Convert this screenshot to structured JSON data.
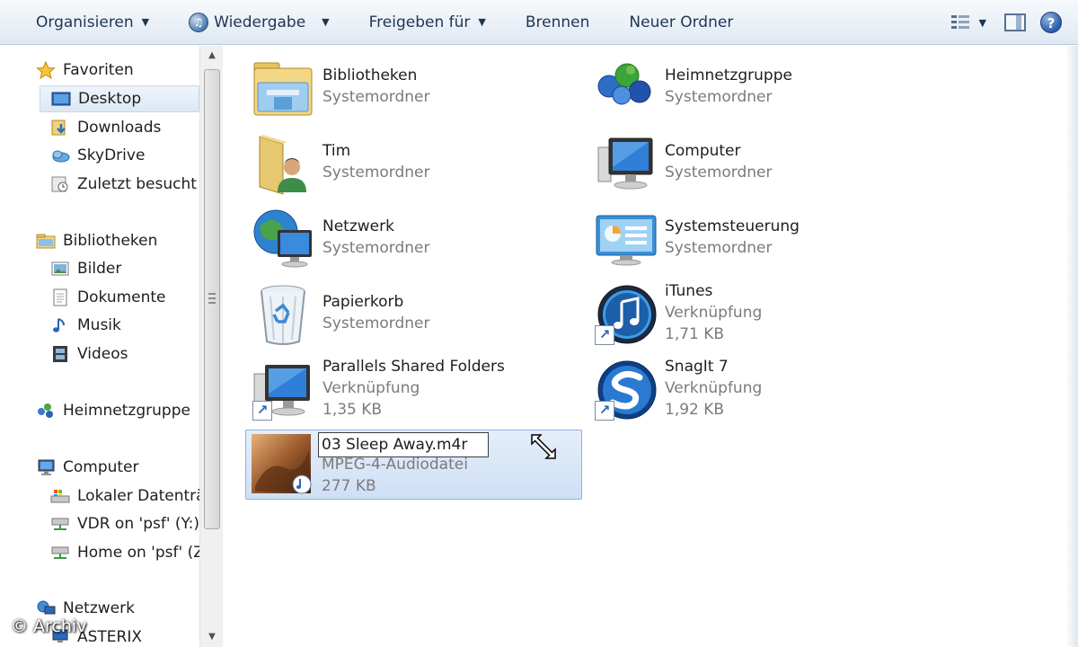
{
  "toolbar": {
    "organize": "Organisieren",
    "play": "Wiedergabe",
    "share": "Freigeben für",
    "burn": "Brennen",
    "new_folder": "Neuer Ordner",
    "help": "?"
  },
  "nav": {
    "favorites": {
      "label": "Favoriten",
      "items": [
        "Desktop",
        "Downloads",
        "SkyDrive",
        "Zuletzt besucht"
      ]
    },
    "libraries": {
      "label": "Bibliotheken",
      "items": [
        "Bilder",
        "Dokumente",
        "Musik",
        "Videos"
      ]
    },
    "homegroup": "Heimnetzgruppe",
    "computer": {
      "label": "Computer",
      "items": [
        "Lokaler Datenträg",
        "VDR on 'psf' (Y:)",
        "Home on 'psf' (Z"
      ]
    },
    "network": {
      "label": "Netzwerk",
      "items": [
        "ASTERIX"
      ]
    }
  },
  "items": [
    {
      "name": "Bibliotheken",
      "line2": "Systemordner",
      "line3": "",
      "icon": "library-folder-icon"
    },
    {
      "name": "Heimnetzgruppe",
      "line2": "Systemordner",
      "line3": "",
      "icon": "homegroup-icon"
    },
    {
      "name": "Tim",
      "line2": "Systemordner",
      "line3": "",
      "icon": "user-folder-icon"
    },
    {
      "name": "Computer",
      "line2": "Systemordner",
      "line3": "",
      "icon": "computer-icon"
    },
    {
      "name": "Netzwerk",
      "line2": "Systemordner",
      "line3": "",
      "icon": "network-icon"
    },
    {
      "name": "Systemsteuerung",
      "line2": "Systemordner",
      "line3": "",
      "icon": "control-panel-icon"
    },
    {
      "name": "Papierkorb",
      "line2": "Systemordner",
      "line3": "",
      "icon": "recycle-bin-icon"
    },
    {
      "name": "iTunes",
      "line2": "Verknüpfung",
      "line3": "1,71 KB",
      "icon": "itunes-icon"
    },
    {
      "name": "Parallels Shared Folders",
      "line2": "Verknüpfung",
      "line3": "1,35 KB",
      "icon": "parallels-shared-icon"
    },
    {
      "name": "SnagIt 7",
      "line2": "Verknüpfung",
      "line3": "1,92 KB",
      "icon": "snagit-icon"
    }
  ],
  "selected_file": {
    "name": "03 Sleep Away.m4r",
    "type": "MPEG-4-Audiodatei",
    "size": "277 KB",
    "icon": "audio-file-icon"
  },
  "watermark": "© Archiv"
}
